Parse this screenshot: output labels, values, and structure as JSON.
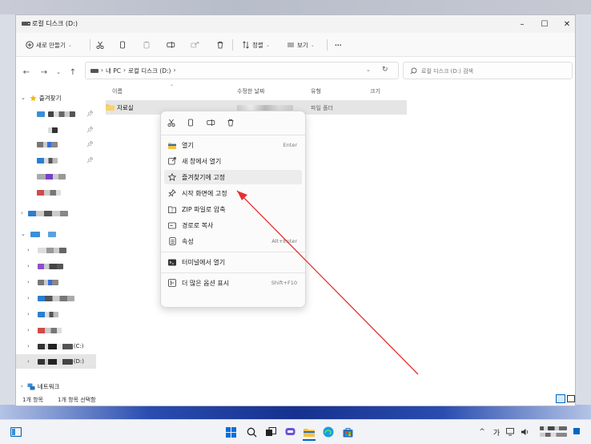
{
  "window": {
    "title": "로컬 디스크 (D:)",
    "controls": {
      "minimize": "–",
      "maximize": "☐",
      "close": "✕"
    }
  },
  "toolbar": {
    "new_label": "새로 만들기",
    "sort_label": "정렬",
    "view_label": "보기",
    "more_label": "···"
  },
  "address": {
    "crumbs": [
      "내 PC",
      "로컬 디스크 (D:)"
    ],
    "search_placeholder": "로컬 디스크 (D:) 검색"
  },
  "sidebar": {
    "favorites_label": "즐겨찾기",
    "drive_c_suffix": "(C:)",
    "drive_d_suffix": "(D:)",
    "network_label": "네트워크"
  },
  "columns": {
    "name": "이름",
    "modified": "수정한 날짜",
    "type": "유형",
    "size": "크기"
  },
  "files": [
    {
      "name": "자료실",
      "type": "파일 폴더"
    }
  ],
  "context_menu": {
    "items": [
      {
        "label": "열기",
        "shortcut": "Enter",
        "icon": "folder-open-icon"
      },
      {
        "label": "새 창에서 열기",
        "shortcut": "",
        "icon": "new-window-icon"
      },
      {
        "label": "즐겨찾기에 고정",
        "shortcut": "",
        "icon": "star-icon"
      },
      {
        "label": "시작 화면에 고정",
        "shortcut": "",
        "icon": "pin-icon"
      },
      {
        "label": "ZIP 파일로 압축",
        "shortcut": "",
        "icon": "zip-icon"
      },
      {
        "label": "경로로 복사",
        "shortcut": "",
        "icon": "copy-path-icon"
      },
      {
        "label": "속성",
        "shortcut": "Alt+Enter",
        "icon": "properties-icon"
      },
      {
        "label": "터미널에서 열기",
        "shortcut": "",
        "icon": "terminal-icon"
      },
      {
        "label": "더 많은 옵션 표시",
        "shortcut": "Shift+F10",
        "icon": "more-options-icon"
      }
    ]
  },
  "status": {
    "count": "1개 항목",
    "selected": "1개 항목 선택함"
  },
  "taskbar": {
    "tray_lang": "가"
  },
  "colors": {
    "accent": "#0067c0",
    "folder": "#f5c244",
    "annotation_arrow": "#e53030",
    "selection": "#e5e5e5"
  }
}
